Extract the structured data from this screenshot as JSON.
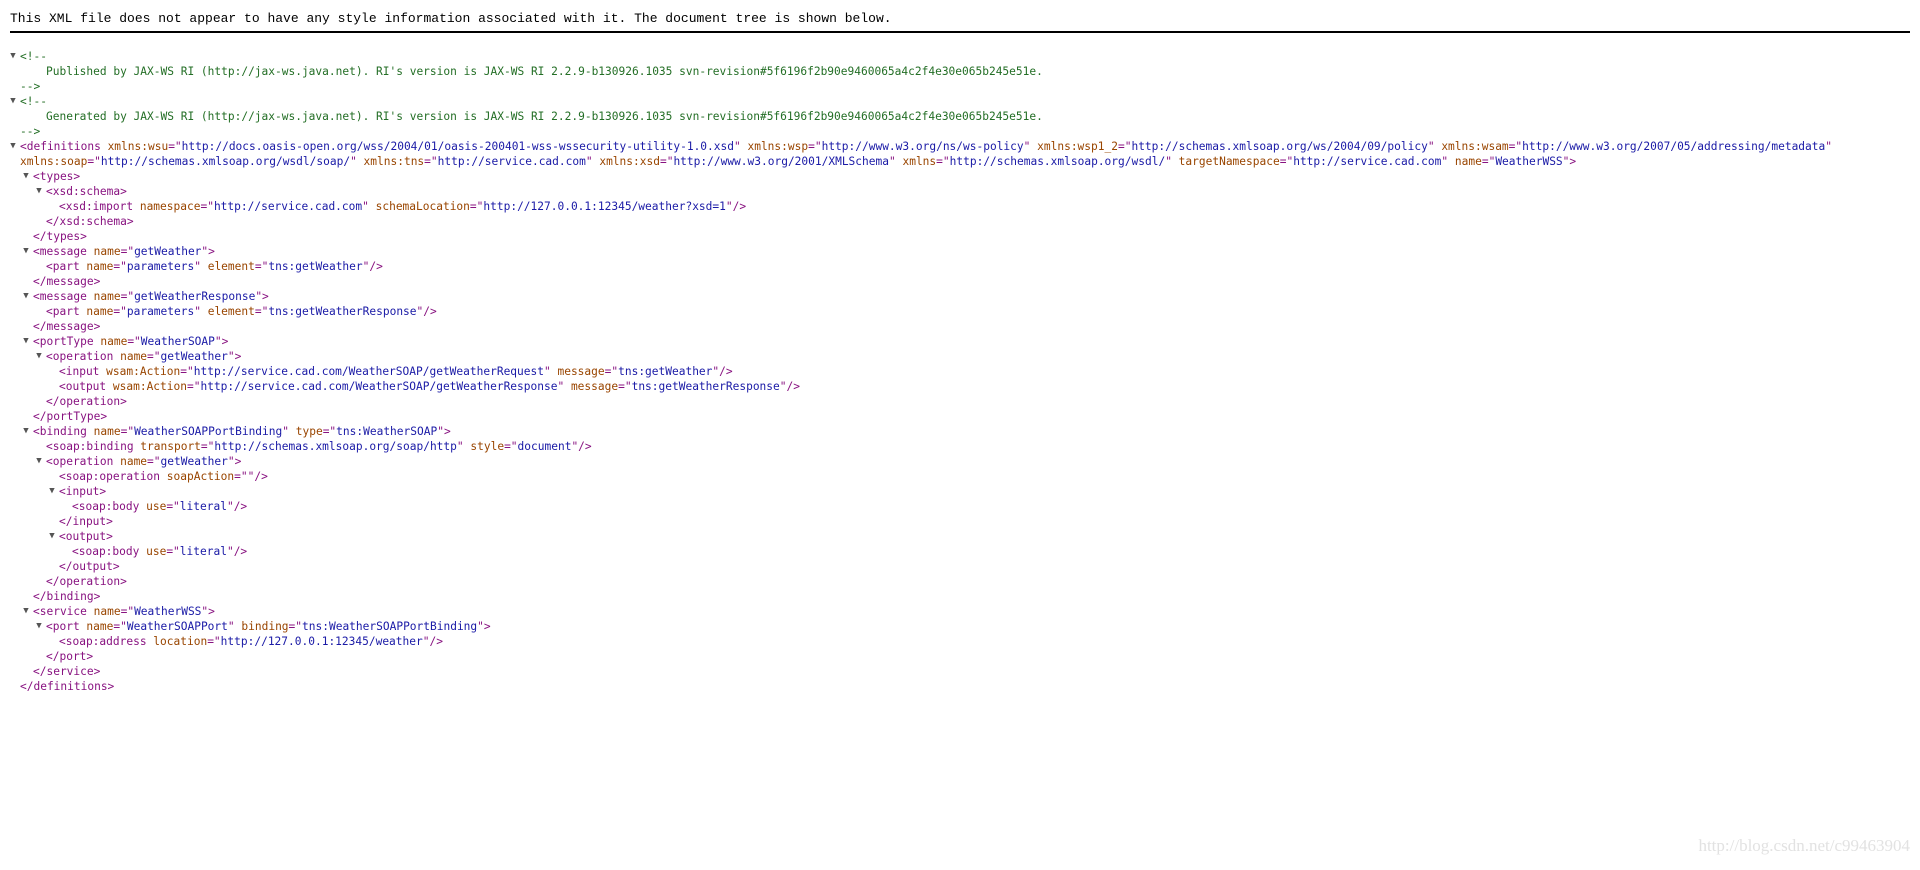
{
  "notice": "This XML file does not appear to have any style information associated with it. The document tree is shown below.",
  "watermark": "http://blog.csdn.net/c99463904",
  "colors": {
    "tag": "#881280",
    "attribute_name": "#994500",
    "attribute_value": "#1a1aa6",
    "comment": "#236e25"
  },
  "tree": [
    {
      "indent": 0,
      "toggle": true,
      "parts": [
        [
          "cm",
          "<!--"
        ]
      ]
    },
    {
      "indent": 2,
      "parts": [
        [
          "cm",
          "Published by JAX-WS RI (http://jax-ws.java.net). RI's version is JAX-WS RI 2.2.9-b130926.1035 svn-revision#5f6196f2b90e9460065a4c2f4e30e065b245e51e."
        ]
      ]
    },
    {
      "indent": 0,
      "parts": [
        [
          "cm",
          "-->"
        ]
      ]
    },
    {
      "indent": 0,
      "toggle": true,
      "parts": [
        [
          "cm",
          "<!--"
        ]
      ]
    },
    {
      "indent": 2,
      "parts": [
        [
          "cm",
          "Generated by JAX-WS RI (http://jax-ws.java.net). RI's version is JAX-WS RI 2.2.9-b130926.1035 svn-revision#5f6196f2b90e9460065a4c2f4e30e065b245e51e."
        ]
      ]
    },
    {
      "indent": 0,
      "parts": [
        [
          "cm",
          "-->"
        ]
      ]
    },
    {
      "indent": 0,
      "toggle": true,
      "parts": [
        [
          "tag",
          "<definitions "
        ],
        [
          "an",
          "xmlns:wsu"
        ],
        [
          "tag",
          "=\""
        ],
        [
          "av",
          "http://docs.oasis-open.org/wss/2004/01/oasis-200401-wss-wssecurity-utility-1.0.xsd"
        ],
        [
          "tag",
          "\" "
        ],
        [
          "an",
          "xmlns:wsp"
        ],
        [
          "tag",
          "=\""
        ],
        [
          "av",
          "http://www.w3.org/ns/ws-policy"
        ],
        [
          "tag",
          "\" "
        ],
        [
          "an",
          "xmlns:wsp1_2"
        ],
        [
          "tag",
          "=\""
        ],
        [
          "av",
          "http://schemas.xmlsoap.org/ws/2004/09/policy"
        ],
        [
          "tag",
          "\" "
        ],
        [
          "an",
          "xmlns:wsam"
        ],
        [
          "tag",
          "=\""
        ],
        [
          "av",
          "http://www.w3.org/2007/05/addressing/metadata"
        ],
        [
          "tag",
          "\""
        ]
      ]
    },
    {
      "indent": 0,
      "parts": [
        [
          "an",
          "xmlns:soap"
        ],
        [
          "tag",
          "=\""
        ],
        [
          "av",
          "http://schemas.xmlsoap.org/wsdl/soap/"
        ],
        [
          "tag",
          "\" "
        ],
        [
          "an",
          "xmlns:tns"
        ],
        [
          "tag",
          "=\""
        ],
        [
          "av",
          "http://service.cad.com"
        ],
        [
          "tag",
          "\" "
        ],
        [
          "an",
          "xmlns:xsd"
        ],
        [
          "tag",
          "=\""
        ],
        [
          "av",
          "http://www.w3.org/2001/XMLSchema"
        ],
        [
          "tag",
          "\" "
        ],
        [
          "an",
          "xmlns"
        ],
        [
          "tag",
          "=\""
        ],
        [
          "av",
          "http://schemas.xmlsoap.org/wsdl/"
        ],
        [
          "tag",
          "\" "
        ],
        [
          "an",
          "targetNamespace"
        ],
        [
          "tag",
          "=\""
        ],
        [
          "av",
          "http://service.cad.com"
        ],
        [
          "tag",
          "\" "
        ],
        [
          "an",
          "name"
        ],
        [
          "tag",
          "=\""
        ],
        [
          "av",
          "WeatherWSS"
        ],
        [
          "tag",
          "\">"
        ]
      ]
    },
    {
      "indent": 1,
      "toggle": true,
      "parts": [
        [
          "tag",
          "<types>"
        ]
      ]
    },
    {
      "indent": 2,
      "toggle": true,
      "parts": [
        [
          "tag",
          "<xsd:schema>"
        ]
      ]
    },
    {
      "indent": 3,
      "parts": [
        [
          "tag",
          "<xsd:import "
        ],
        [
          "an",
          "namespace"
        ],
        [
          "tag",
          "=\""
        ],
        [
          "av",
          "http://service.cad.com"
        ],
        [
          "tag",
          "\" "
        ],
        [
          "an",
          "schemaLocation"
        ],
        [
          "tag",
          "=\""
        ],
        [
          "av",
          "http://127.0.0.1:12345/weather?xsd=1"
        ],
        [
          "tag",
          "\"/>"
        ]
      ]
    },
    {
      "indent": 2,
      "parts": [
        [
          "tag",
          "</xsd:schema>"
        ]
      ]
    },
    {
      "indent": 1,
      "parts": [
        [
          "tag",
          "</types>"
        ]
      ]
    },
    {
      "indent": 1,
      "toggle": true,
      "parts": [
        [
          "tag",
          "<message "
        ],
        [
          "an",
          "name"
        ],
        [
          "tag",
          "=\""
        ],
        [
          "av",
          "getWeather"
        ],
        [
          "tag",
          "\">"
        ]
      ]
    },
    {
      "indent": 2,
      "parts": [
        [
          "tag",
          "<part "
        ],
        [
          "an",
          "name"
        ],
        [
          "tag",
          "=\""
        ],
        [
          "av",
          "parameters"
        ],
        [
          "tag",
          "\" "
        ],
        [
          "an",
          "element"
        ],
        [
          "tag",
          "=\""
        ],
        [
          "av",
          "tns:getWeather"
        ],
        [
          "tag",
          "\"/>"
        ]
      ]
    },
    {
      "indent": 1,
      "parts": [
        [
          "tag",
          "</message>"
        ]
      ]
    },
    {
      "indent": 1,
      "toggle": true,
      "parts": [
        [
          "tag",
          "<message "
        ],
        [
          "an",
          "name"
        ],
        [
          "tag",
          "=\""
        ],
        [
          "av",
          "getWeatherResponse"
        ],
        [
          "tag",
          "\">"
        ]
      ]
    },
    {
      "indent": 2,
      "parts": [
        [
          "tag",
          "<part "
        ],
        [
          "an",
          "name"
        ],
        [
          "tag",
          "=\""
        ],
        [
          "av",
          "parameters"
        ],
        [
          "tag",
          "\" "
        ],
        [
          "an",
          "element"
        ],
        [
          "tag",
          "=\""
        ],
        [
          "av",
          "tns:getWeatherResponse"
        ],
        [
          "tag",
          "\"/>"
        ]
      ]
    },
    {
      "indent": 1,
      "parts": [
        [
          "tag",
          "</message>"
        ]
      ]
    },
    {
      "indent": 1,
      "toggle": true,
      "parts": [
        [
          "tag",
          "<portType "
        ],
        [
          "an",
          "name"
        ],
        [
          "tag",
          "=\""
        ],
        [
          "av",
          "WeatherSOAP"
        ],
        [
          "tag",
          "\">"
        ]
      ]
    },
    {
      "indent": 2,
      "toggle": true,
      "parts": [
        [
          "tag",
          "<operation "
        ],
        [
          "an",
          "name"
        ],
        [
          "tag",
          "=\""
        ],
        [
          "av",
          "getWeather"
        ],
        [
          "tag",
          "\">"
        ]
      ]
    },
    {
      "indent": 3,
      "parts": [
        [
          "tag",
          "<input "
        ],
        [
          "an",
          "wsam:Action"
        ],
        [
          "tag",
          "=\""
        ],
        [
          "av",
          "http://service.cad.com/WeatherSOAP/getWeatherRequest"
        ],
        [
          "tag",
          "\" "
        ],
        [
          "an",
          "message"
        ],
        [
          "tag",
          "=\""
        ],
        [
          "av",
          "tns:getWeather"
        ],
        [
          "tag",
          "\"/>"
        ]
      ]
    },
    {
      "indent": 3,
      "parts": [
        [
          "tag",
          "<output "
        ],
        [
          "an",
          "wsam:Action"
        ],
        [
          "tag",
          "=\""
        ],
        [
          "av",
          "http://service.cad.com/WeatherSOAP/getWeatherResponse"
        ],
        [
          "tag",
          "\" "
        ],
        [
          "an",
          "message"
        ],
        [
          "tag",
          "=\""
        ],
        [
          "av",
          "tns:getWeatherResponse"
        ],
        [
          "tag",
          "\"/>"
        ]
      ]
    },
    {
      "indent": 2,
      "parts": [
        [
          "tag",
          "</operation>"
        ]
      ]
    },
    {
      "indent": 1,
      "parts": [
        [
          "tag",
          "</portType>"
        ]
      ]
    },
    {
      "indent": 1,
      "toggle": true,
      "parts": [
        [
          "tag",
          "<binding "
        ],
        [
          "an",
          "name"
        ],
        [
          "tag",
          "=\""
        ],
        [
          "av",
          "WeatherSOAPPortBinding"
        ],
        [
          "tag",
          "\" "
        ],
        [
          "an",
          "type"
        ],
        [
          "tag",
          "=\""
        ],
        [
          "av",
          "tns:WeatherSOAP"
        ],
        [
          "tag",
          "\">"
        ]
      ]
    },
    {
      "indent": 2,
      "parts": [
        [
          "tag",
          "<soap:binding "
        ],
        [
          "an",
          "transport"
        ],
        [
          "tag",
          "=\""
        ],
        [
          "av",
          "http://schemas.xmlsoap.org/soap/http"
        ],
        [
          "tag",
          "\" "
        ],
        [
          "an",
          "style"
        ],
        [
          "tag",
          "=\""
        ],
        [
          "av",
          "document"
        ],
        [
          "tag",
          "\"/>"
        ]
      ]
    },
    {
      "indent": 2,
      "toggle": true,
      "parts": [
        [
          "tag",
          "<operation "
        ],
        [
          "an",
          "name"
        ],
        [
          "tag",
          "=\""
        ],
        [
          "av",
          "getWeather"
        ],
        [
          "tag",
          "\">"
        ]
      ]
    },
    {
      "indent": 3,
      "parts": [
        [
          "tag",
          "<soap:operation "
        ],
        [
          "an",
          "soapAction"
        ],
        [
          "tag",
          "=\""
        ],
        [
          "av",
          ""
        ],
        [
          "tag",
          "\"/>"
        ]
      ]
    },
    {
      "indent": 3,
      "toggle": true,
      "parts": [
        [
          "tag",
          "<input>"
        ]
      ]
    },
    {
      "indent": 4,
      "parts": [
        [
          "tag",
          "<soap:body "
        ],
        [
          "an",
          "use"
        ],
        [
          "tag",
          "=\""
        ],
        [
          "av",
          "literal"
        ],
        [
          "tag",
          "\"/>"
        ]
      ]
    },
    {
      "indent": 3,
      "parts": [
        [
          "tag",
          "</input>"
        ]
      ]
    },
    {
      "indent": 3,
      "toggle": true,
      "parts": [
        [
          "tag",
          "<output>"
        ]
      ]
    },
    {
      "indent": 4,
      "parts": [
        [
          "tag",
          "<soap:body "
        ],
        [
          "an",
          "use"
        ],
        [
          "tag",
          "=\""
        ],
        [
          "av",
          "literal"
        ],
        [
          "tag",
          "\"/>"
        ]
      ]
    },
    {
      "indent": 3,
      "parts": [
        [
          "tag",
          "</output>"
        ]
      ]
    },
    {
      "indent": 2,
      "parts": [
        [
          "tag",
          "</operation>"
        ]
      ]
    },
    {
      "indent": 1,
      "parts": [
        [
          "tag",
          "</binding>"
        ]
      ]
    },
    {
      "indent": 1,
      "toggle": true,
      "parts": [
        [
          "tag",
          "<service "
        ],
        [
          "an",
          "name"
        ],
        [
          "tag",
          "=\""
        ],
        [
          "av",
          "WeatherWSS"
        ],
        [
          "tag",
          "\">"
        ]
      ]
    },
    {
      "indent": 2,
      "toggle": true,
      "parts": [
        [
          "tag",
          "<port "
        ],
        [
          "an",
          "name"
        ],
        [
          "tag",
          "=\""
        ],
        [
          "av",
          "WeatherSOAPPort"
        ],
        [
          "tag",
          "\" "
        ],
        [
          "an",
          "binding"
        ],
        [
          "tag",
          "=\""
        ],
        [
          "av",
          "tns:WeatherSOAPPortBinding"
        ],
        [
          "tag",
          "\">"
        ]
      ]
    },
    {
      "indent": 3,
      "parts": [
        [
          "tag",
          "<soap:address "
        ],
        [
          "an",
          "location"
        ],
        [
          "tag",
          "=\""
        ],
        [
          "av",
          "http://127.0.0.1:12345/weather"
        ],
        [
          "tag",
          "\"/>"
        ]
      ]
    },
    {
      "indent": 2,
      "parts": [
        [
          "tag",
          "</port>"
        ]
      ]
    },
    {
      "indent": 1,
      "parts": [
        [
          "tag",
          "</service>"
        ]
      ]
    },
    {
      "indent": 0,
      "parts": [
        [
          "tag",
          "</definitions>"
        ]
      ]
    }
  ]
}
